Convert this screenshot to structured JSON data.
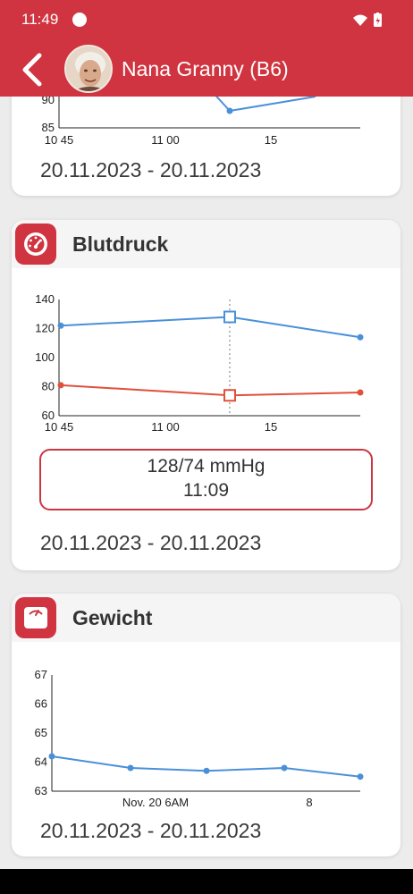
{
  "status_bar": {
    "time": "11:49"
  },
  "header": {
    "title": "Nana Granny (B6)"
  },
  "cards": [
    {
      "title": "",
      "date_range": "20.11.2023 - 20.11.2023",
      "chart_data": {
        "type": "line",
        "x_ticks": [
          "10 45",
          "11 00",
          "15"
        ],
        "y_ticks": [
          "85",
          "90"
        ],
        "series": [
          {
            "values": [
              92,
              88,
              91
            ]
          }
        ]
      }
    },
    {
      "title": "Blutdruck",
      "icon": "gauge-icon",
      "date_range": "20.11.2023 - 20.11.2023",
      "tooltip": {
        "value": "128/74 mmHg",
        "time": "11:09"
      },
      "chart_data": {
        "type": "line",
        "x_ticks": [
          "10 45",
          "11 00",
          "15"
        ],
        "y_ticks": [
          "60",
          "80",
          "100",
          "120",
          "140"
        ],
        "ylim": [
          60,
          140
        ],
        "series": [
          {
            "color": "#4a90d9",
            "values": [
              122,
              128,
              114
            ]
          },
          {
            "color": "#e0503a",
            "values": [
              81,
              74,
              76
            ]
          }
        ]
      }
    },
    {
      "title": "Gewicht",
      "icon": "scale-icon",
      "date_range": "20.11.2023 - 20.11.2023",
      "chart_data": {
        "type": "line",
        "x_ticks": [
          "Nov. 20 6AM",
          "8"
        ],
        "y_ticks": [
          "63",
          "64",
          "65",
          "66",
          "67"
        ],
        "ylim": [
          63,
          67
        ],
        "series": [
          {
            "color": "#4a90d9",
            "values": [
              64.2,
              63.8,
              63.7,
              63.8,
              63.5
            ]
          }
        ]
      }
    }
  ]
}
